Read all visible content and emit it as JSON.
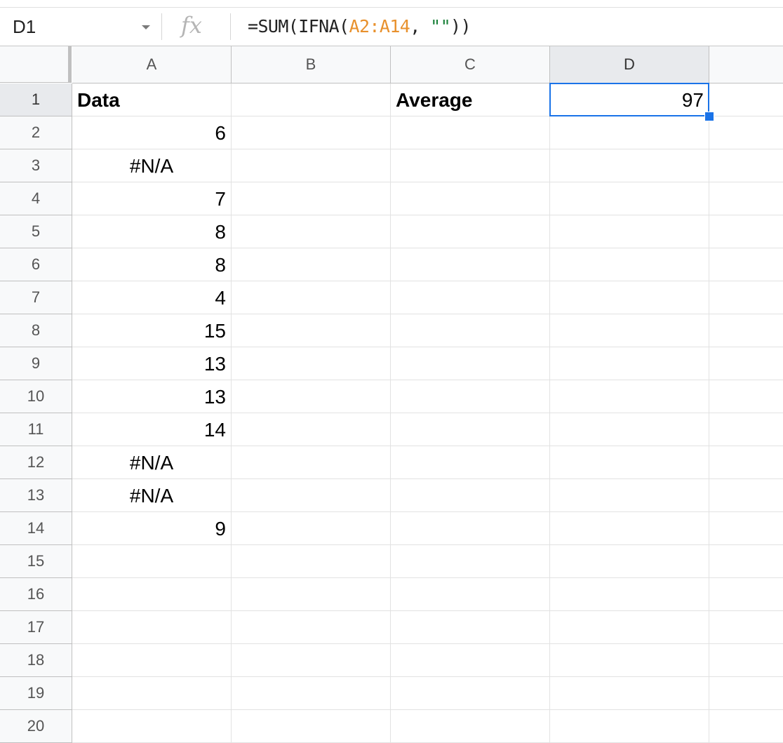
{
  "formula_bar": {
    "name_box": "D1",
    "fx_label": "fx",
    "formula_parts": [
      {
        "text": "=SUM(IFNA(",
        "color": "#222222"
      },
      {
        "text": "A2:A14",
        "color": "#e8912d"
      },
      {
        "text": ", ",
        "color": "#222222"
      },
      {
        "text": "\"\"",
        "color": "#188038"
      },
      {
        "text": "))",
        "color": "#222222"
      }
    ]
  },
  "columns": [
    "A",
    "B",
    "C",
    "D"
  ],
  "selected_column": "D",
  "selected_row": "1",
  "rows": [
    {
      "num": "1",
      "A": "Data",
      "C": "Average",
      "D": "97"
    },
    {
      "num": "2",
      "A": "6"
    },
    {
      "num": "3",
      "A": "#N/A"
    },
    {
      "num": "4",
      "A": "7"
    },
    {
      "num": "5",
      "A": "8"
    },
    {
      "num": "6",
      "A": "8"
    },
    {
      "num": "7",
      "A": "4"
    },
    {
      "num": "8",
      "A": "15"
    },
    {
      "num": "9",
      "A": "13"
    },
    {
      "num": "10",
      "A": "13"
    },
    {
      "num": "11",
      "A": "14"
    },
    {
      "num": "12",
      "A": "#N/A"
    },
    {
      "num": "13",
      "A": "#N/A"
    },
    {
      "num": "14",
      "A": "9"
    },
    {
      "num": "15"
    },
    {
      "num": "16"
    },
    {
      "num": "17"
    },
    {
      "num": "18"
    },
    {
      "num": "19"
    },
    {
      "num": "20"
    }
  ],
  "colors": {
    "selection": "#1a73e8",
    "range_ref": "#e8912d",
    "string_literal": "#188038"
  }
}
